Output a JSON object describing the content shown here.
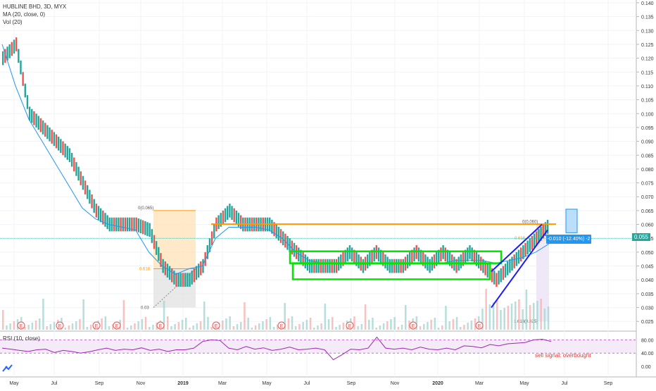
{
  "legend": {
    "symbol": "HUBLINE BHD, 3D, MYX",
    "ma": "MA (20, close, 0)",
    "vol": "Vol (20)",
    "rsi": "RSI (10, close)"
  },
  "badges": {
    "last_price": "0.055",
    "measure": "-0.010 (-12.40%) -2",
    "sell_signal": "sell signal: overbought"
  },
  "colors": {
    "up": "#26a69a",
    "down": "#ef5350",
    "ma": "#2196f3",
    "resistance": "#ff9800",
    "box": "#00e600",
    "channel": "#1a1aff",
    "rsi": "#9c27b0",
    "fib_fill": "#ffe0b2"
  },
  "chart_data": [
    {
      "type": "candlestick",
      "title": "HUBLINE BHD, 3D, MYX",
      "price_ticks": [
        "0.140",
        "0.135",
        "0.130",
        "0.125",
        "0.120",
        "0.115",
        "0.110",
        "0.105",
        "0.100",
        "0.095",
        "0.090",
        "0.085",
        "0.080",
        "0.075",
        "0.070",
        "0.065",
        "0.060",
        "0.055",
        "0.050",
        "0.045",
        "0.040",
        "0.035",
        "0.030",
        "0.025"
      ],
      "ylim": [
        0.0215,
        0.141
      ],
      "x_ticks": [
        "May",
        "Jul",
        "Sep",
        "Nov",
        "2019",
        "Mar",
        "May",
        "Jul",
        "Sep",
        "Nov",
        "2020",
        "Mar",
        "May",
        "Jul",
        "Sep"
      ],
      "series": [
        {
          "name": "MA (20, close, 0)",
          "values": [
            0.125,
            0.11,
            0.098,
            0.09,
            0.082,
            0.074,
            0.066,
            0.062,
            0.06,
            0.059,
            0.058,
            0.05,
            0.045,
            0.042,
            0.044,
            0.045,
            0.055,
            0.059,
            0.059,
            0.059,
            0.058,
            0.055,
            0.05,
            0.047,
            0.046,
            0.046,
            0.046,
            0.046,
            0.046,
            0.046,
            0.046,
            0.046,
            0.046,
            0.046,
            0.047,
            0.047,
            0.047,
            0.046,
            0.047,
            0.048,
            0.05,
            0.053
          ]
        }
      ],
      "close_path": [
        0.12,
        0.125,
        0.1,
        0.095,
        0.09,
        0.085,
        0.075,
        0.065,
        0.06,
        0.06,
        0.06,
        0.058,
        0.045,
        0.04,
        0.04,
        0.045,
        0.06,
        0.065,
        0.06,
        0.06,
        0.06,
        0.055,
        0.05,
        0.045,
        0.045,
        0.045,
        0.05,
        0.045,
        0.05,
        0.045,
        0.045,
        0.05,
        0.045,
        0.05,
        0.045,
        0.05,
        0.045,
        0.04,
        0.045,
        0.05,
        0.055,
        0.06
      ],
      "annotations": {
        "resistance": 0.0601,
        "box_top": 0.0503,
        "box_bottom": 0.0402,
        "fib_top": "0(0.065)",
        "fib_mid": "0.618",
        "fib_low": "0.03",
        "fib_right_top": "0(0.060)",
        "fib_right_mid": "0.618",
        "fib_right_bottom": "1.618(0.025)"
      },
      "event_markers": [
        "E",
        "E",
        "E",
        "E",
        "E",
        "E",
        "E",
        "E",
        "E",
        "E",
        "E"
      ]
    },
    {
      "type": "line",
      "title": "RSI (10, close)",
      "y_ticks": [
        "80.00",
        "40.00",
        "0.00"
      ],
      "ylim": [
        0,
        100
      ],
      "band": [
        40,
        80
      ],
      "values": [
        55,
        52,
        48,
        45,
        50,
        52,
        42,
        48,
        45,
        40,
        44,
        50,
        55,
        48,
        52,
        50,
        56,
        48,
        52,
        45,
        50,
        50,
        55,
        75,
        80,
        78,
        55,
        50,
        60,
        52,
        56,
        48,
        52,
        58,
        50,
        52,
        55,
        50,
        20,
        35,
        52,
        50,
        55,
        88,
        55,
        52,
        55,
        50,
        58,
        52,
        50,
        55,
        50,
        62,
        60,
        56,
        66,
        62,
        68,
        70,
        72,
        80,
        82,
        75
      ]
    }
  ]
}
